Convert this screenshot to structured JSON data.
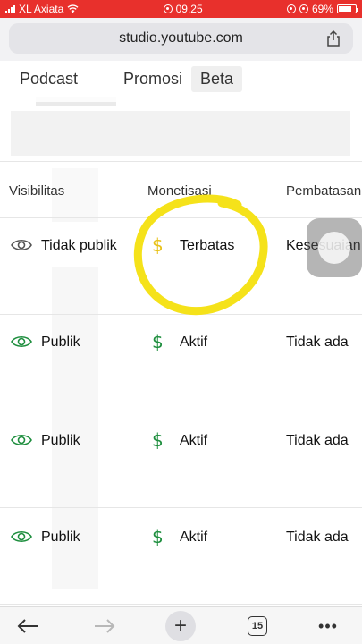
{
  "status_bar": {
    "carrier": "XL Axiata",
    "time": "09.25",
    "battery": "69%"
  },
  "browser": {
    "url": "studio.youtube.com",
    "tab_count": "15"
  },
  "tabs": {
    "podcast": "Podcast",
    "promosi": "Promosi",
    "beta": "Beta"
  },
  "table": {
    "headers": {
      "visibility": "Visibilitas",
      "monetization": "Monetisasi",
      "restrictions": "Pembatasan"
    },
    "rows": [
      {
        "visibility": "Tidak publik",
        "monetization": "Terbatas",
        "restriction": "Kesesuaian"
      },
      {
        "visibility": "Publik",
        "monetization": "Aktif",
        "restriction": "Tidak ada"
      },
      {
        "visibility": "Publik",
        "monetization": "Aktif",
        "restriction": "Tidak ada"
      },
      {
        "visibility": "Publik",
        "monetization": "Aktif",
        "restriction": "Tidak ada"
      }
    ]
  },
  "colors": {
    "status_bar": "#e8302c",
    "active_green": "#1e8e3e",
    "limited_yellow": "#e8c21a",
    "annotation_yellow": "#f5e21a"
  },
  "icons": {
    "visibility": "eye-icon",
    "monetization": "dollar-icon"
  }
}
